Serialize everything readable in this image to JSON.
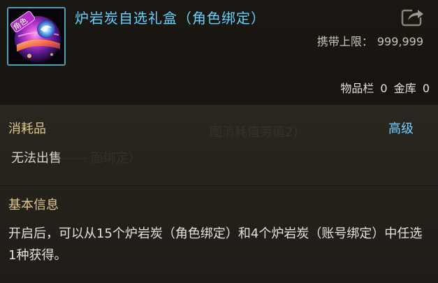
{
  "item": {
    "title": "炉岩炭自选礼盒（角色绑定）",
    "icon_name": "gift-box-orb-icon",
    "icon_badge": "角色",
    "carry_limit_label": "携带上限：",
    "carry_limit_value": "999,999",
    "inventory_label": "物品栏",
    "inventory_count": "0",
    "bank_label": "金库",
    "bank_count": "0",
    "type": "消耗品",
    "grade": "高级",
    "sell_status": "无法出售"
  },
  "info": {
    "section_title": "基本信息",
    "description": "开启后，可以从15个炉岩炭（角色绑定）和4个炉岩炭（账号绑定）中任选1种获得。"
  },
  "colors": {
    "title": "#64d2ff",
    "grade": "#6fd0ff",
    "section_heading": "#e0c78e",
    "body_text": "#e6e2da",
    "icon_border": "#4fa3b8"
  }
}
